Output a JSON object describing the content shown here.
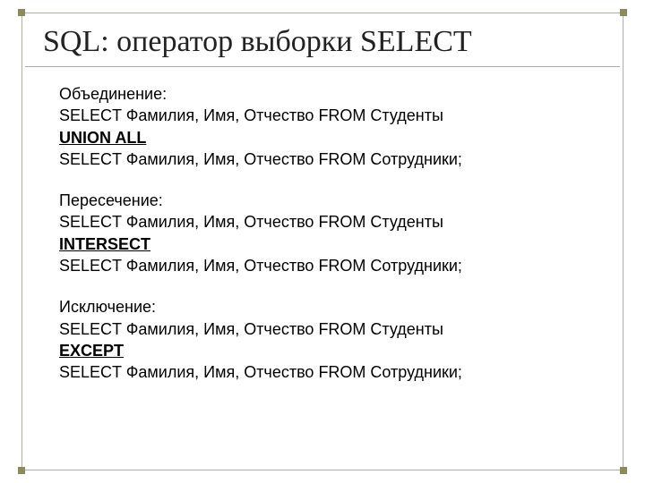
{
  "title": "SQL: оператор выборки SELECT",
  "blocks": {
    "union": {
      "label": "Объединение:",
      "l1": "SELECT Фамилия, Имя, Отчество FROM Студенты",
      "kw": "UNION ALL",
      "l2": "SELECT Фамилия, Имя, Отчество FROM Сотрудники;"
    },
    "intersect": {
      "label": "Пересечение:",
      "l1": "SELECT Фамилия, Имя, Отчество FROM Студенты",
      "kw": "INTERSECT",
      "l2": "SELECT Фамилия, Имя, Отчество FROM Сотрудники;"
    },
    "except": {
      "label": "Исключение:",
      "l1": "SELECT Фамилия, Имя, Отчество FROM Студенты",
      "kw": "EXCEPT",
      "l2": "SELECT Фамилия, Имя, Отчество FROM Сотрудники;"
    }
  }
}
